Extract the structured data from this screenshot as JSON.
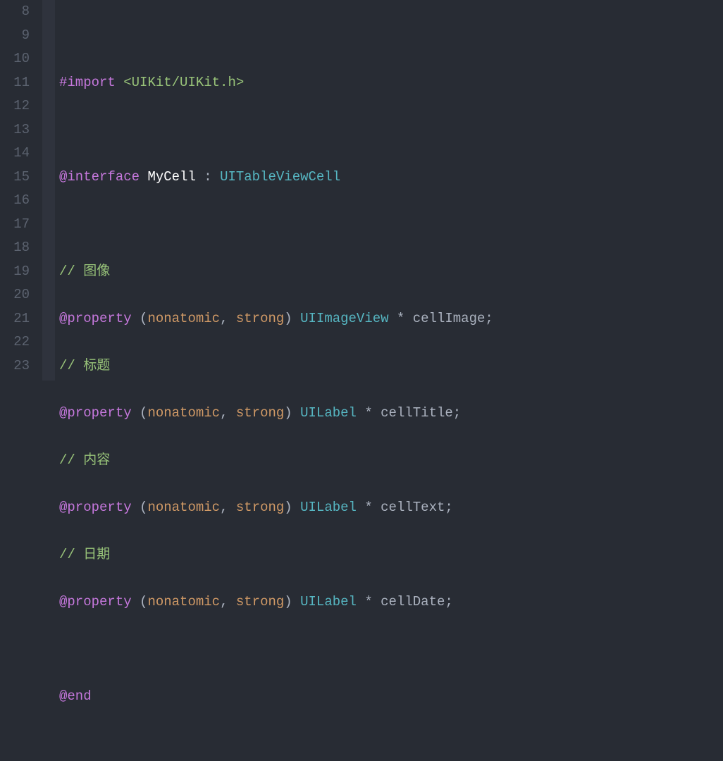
{
  "lines": {
    "start": 8,
    "end": 23
  },
  "code": {
    "l9": {
      "import_kw": "#import",
      "header": "<UIKit/UIKit.h>"
    },
    "l11": {
      "interface_kw": "@interface",
      "class_name": "MyCell",
      "colon": " : ",
      "super": "UITableViewCell"
    },
    "c_image": "// 图像",
    "p1": {
      "kw": "@property",
      "lp": " (",
      "a1": "nonatomic",
      "comma": ", ",
      "a2": "strong",
      "rp": ") ",
      "type": "UIImageView",
      "star": " * ",
      "name": "cellImage",
      "semi": ";"
    },
    "c_title": "// 标题",
    "p2": {
      "kw": "@property",
      "lp": " (",
      "a1": "nonatomic",
      "comma": ", ",
      "a2": "strong",
      "rp": ") ",
      "type": "UILabel",
      "star": " * ",
      "name": "cellTitle",
      "semi": ";"
    },
    "c_text": "// 内容",
    "p3": {
      "kw": "@property",
      "lp": " (",
      "a1": "nonatomic",
      "comma": ", ",
      "a2": "strong",
      "rp": ") ",
      "type": "UILabel",
      "star": " * ",
      "name": "cellText",
      "semi": ";"
    },
    "c_date": "// 日期",
    "p4": {
      "kw": "@property",
      "lp": " (",
      "a1": "nonatomic",
      "comma": ", ",
      "a2": "strong",
      "rp": ") ",
      "type": "UILabel",
      "star": " * ",
      "name": "cellDate",
      "semi": ";"
    },
    "end_kw": "@end"
  }
}
